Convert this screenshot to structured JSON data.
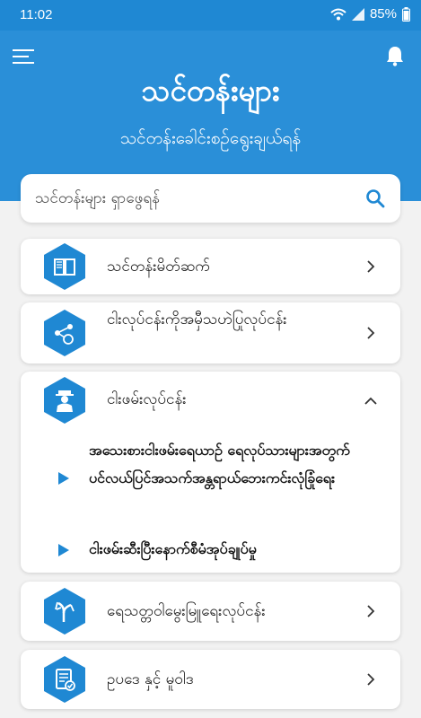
{
  "status_bar": {
    "time": "11:02",
    "battery": "85%",
    "icons": [
      "wifi-icon",
      "signal-icon",
      "battery-icon"
    ]
  },
  "header": {
    "title": "သင်တန်းများ",
    "subtitle": "သင်တန်းခေါင်းစဉ်ရွေးချယ်ရန်",
    "menu_icon": "menu-icon",
    "notification_icon": "bell-icon"
  },
  "search": {
    "placeholder": "သင်တန်းများ ရှာဖွေရန်",
    "value": ""
  },
  "categories": [
    {
      "label": "သင်တန်းမိတ်ဆက်",
      "icon": "book-icon",
      "expanded": false
    },
    {
      "label": "ငါးလုပ်ငန်းကိုအမှီသဟဲပြုလုပ်ငန်း",
      "icon": "share-network-icon",
      "expanded": false
    },
    {
      "label": "ငါးဖမ်းလုပ်ငန်း",
      "icon": "fisherman-icon",
      "expanded": true,
      "sub_items": [
        {
          "label": "အသေးစားငါးဖမ်းရေယာဉ် ရေလုပ်သားများအတွက် ပင်လယ်ပြင်အသက်အန္တရာယ်ဘေးကင်းလုံခြုံရေး"
        },
        {
          "label": "ငါးဖမ်းဆီးပြီးနောက်စီမံအုပ်ချုပ်မှု"
        }
      ]
    },
    {
      "label": "ရေသတ္တဝါမွေးမြူရေးလုပ်ငန်း",
      "icon": "plant-sprout-icon",
      "expanded": false
    },
    {
      "label": "ဥပဒေ နှင့် မူဝါဒ",
      "icon": "document-check-icon",
      "expanded": false
    }
  ],
  "colors": {
    "primary": "#2a8fd8",
    "status_bar": "#1f88d3",
    "accent_icon": "#1f88d3",
    "background": "#f2f2f2"
  }
}
